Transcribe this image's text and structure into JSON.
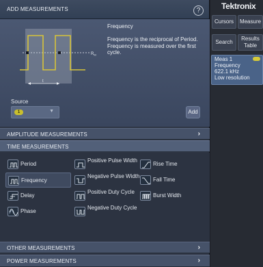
{
  "panel": {
    "title": "ADD MEASUREMENTS",
    "help_glyph": "?",
    "measurement_name": "Frequency",
    "description": "Frequency is the reciprocal of Period. Frequency is measured over the first cycle.",
    "diagram": {
      "ref_label": "R",
      "ref_subscript": "M"
    },
    "source_label": "Source",
    "source_value": "1",
    "add_label": "Add"
  },
  "sections": {
    "amplitude": "AMPLITUDE MEASUREMENTS",
    "time": "TIME MEASUREMENTS",
    "other": "OTHER MEASUREMENTS",
    "power": "POWER MEASUREMENTS",
    "chevron": "›"
  },
  "time_items": {
    "period": "Period",
    "frequency": "Frequency",
    "delay": "Delay",
    "phase": "Phase",
    "positive_pulse_width": "Positive Pulse Width",
    "negative_pulse_width": "Negative Pulse Width",
    "positive_duty_cycle": "Positive Duty Cycle",
    "negative_duty_cycle": "Negative Duty Cycle",
    "rise_time": "Rise Time",
    "fall_time": "Fall Time",
    "burst_width": "Burst Width"
  },
  "right": {
    "brand": "Tektronix",
    "cursors": "Cursors",
    "measure": "Measure",
    "search": "Search",
    "results_table": "Results Table",
    "meas": {
      "name": "Meas 1",
      "type": "Frequency",
      "value": "622.1 kHz",
      "note": "Low resolution"
    }
  },
  "colors": {
    "waveform": "#d8c43a",
    "panel_bg": "#2e3543",
    "accent_meas": "#4a6388"
  }
}
